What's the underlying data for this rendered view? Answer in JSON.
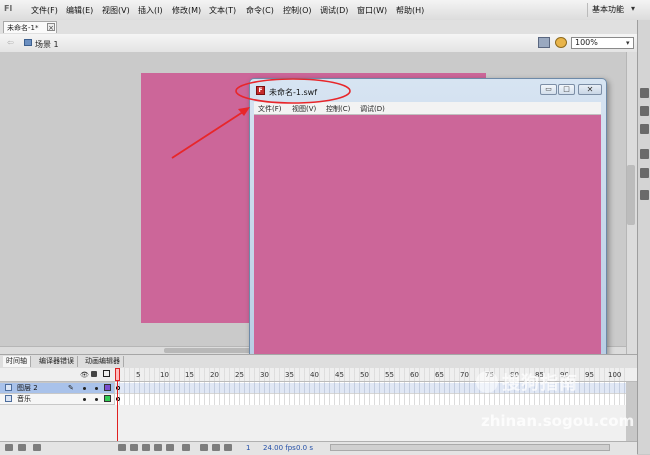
{
  "app": {
    "logo": "Fl",
    "menu": [
      "文件(F)",
      "编辑(E)",
      "视图(V)",
      "插入(I)",
      "修改(M)",
      "文本(T)",
      "命令(C)",
      "控制(O)",
      "调试(D)",
      "窗口(W)",
      "帮助(H)"
    ],
    "workspace": "基本功能"
  },
  "document": {
    "tab_label": "未命名-1*",
    "tab_close": "×"
  },
  "editbar": {
    "scene_label": "场景 1",
    "zoom": "100%"
  },
  "stage": {
    "color": "#cc6699"
  },
  "swf_window": {
    "title": "未命名-1.swf",
    "icon_glyph": "F",
    "min_glyph": "▭",
    "max_glyph": "□",
    "close_glyph": "✕",
    "menu": [
      "文件(F)",
      "视图(V)",
      "控制(C)",
      "调试(D)"
    ]
  },
  "timeline": {
    "tabs": [
      "时间轴",
      "编译器错误",
      "动画编辑器"
    ],
    "ticks": [
      "5",
      "10",
      "15",
      "20",
      "25",
      "30",
      "35",
      "40",
      "45",
      "50",
      "55",
      "60",
      "65",
      "70",
      "75",
      "80",
      "85",
      "90",
      "95",
      "100"
    ],
    "eye_glyph": "👁",
    "layers": [
      {
        "name": "图层 2",
        "selected": true,
        "color": "#7b4fd0"
      },
      {
        "name": "音乐",
        "selected": false,
        "color": "#33cc55"
      }
    ],
    "pencil_glyph": "✎",
    "current_frame": "1",
    "fps": "24.00 fps",
    "time": "0.0 s"
  },
  "watermark": {
    "brand": "搜狗指南",
    "url": "zhinan.sogou.com"
  },
  "colors": {
    "annotation_red": "#e8262a",
    "pink": "#cc6699"
  }
}
